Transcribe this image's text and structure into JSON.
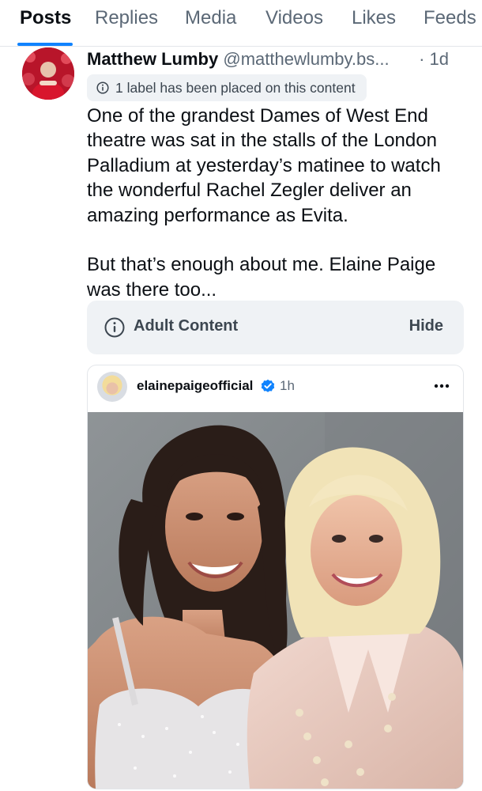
{
  "tabs": [
    {
      "label": "Posts",
      "active": true
    },
    {
      "label": "Replies"
    },
    {
      "label": "Media"
    },
    {
      "label": "Videos"
    },
    {
      "label": "Likes"
    },
    {
      "label": "Feeds"
    }
  ],
  "post": {
    "author": "Matthew Lumby",
    "handle": "@matthewlumby.bs...",
    "time": "· 1d",
    "label_notice": "1 label has been placed on this content",
    "paragraphs": [
      "One of the grandest Dames of West End theatre was sat in the stalls of the London Palladium at yesterday’s matinee to watch the wonderful Rachel Zegler deliver an amazing performance as Evita.",
      "But that’s enough about me. Elaine Paige was there too..."
    ],
    "content_warning": {
      "label": "Adult Content",
      "action": "Hide",
      "icon": "info-icon"
    }
  },
  "quoted_post": {
    "author": "elainepaigeofficial",
    "verified": true,
    "time": "1h",
    "menu_icon": "more-horizontal-icon"
  },
  "colors": {
    "accent": "#1083fe",
    "muted_text": "#5b6876",
    "surface": "#eff2f5"
  }
}
